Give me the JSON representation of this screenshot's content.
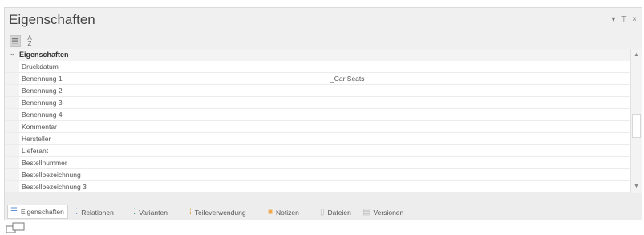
{
  "window": {
    "title": "Eigenschaften",
    "buttons": [
      {
        "name": "dropdown",
        "glyph": "▾"
      },
      {
        "name": "pin",
        "glyph": "⊤"
      },
      {
        "name": "close",
        "glyph": "×"
      }
    ]
  },
  "toolbar": {
    "categorized_icon": "categorized-view-icon",
    "sort_glyph_top": "A",
    "sort_glyph_bottom": "Z",
    "sort_icon": "sort-alphabetical-icon"
  },
  "grid": {
    "category": {
      "toggle": "⌄",
      "label": "Eigenschaften"
    },
    "rows": [
      {
        "name": "Druckdatum",
        "value": ""
      },
      {
        "name": "Benennung 1",
        "value": "_Car Seats"
      },
      {
        "name": "Benennung 2",
        "value": ""
      },
      {
        "name": "Benennung 3",
        "value": ""
      },
      {
        "name": "Benennung 4",
        "value": ""
      },
      {
        "name": "Kommentar",
        "value": ""
      },
      {
        "name": "Hersteller",
        "value": ""
      },
      {
        "name": "Lieferant",
        "value": ""
      },
      {
        "name": "Bestellnummer",
        "value": ""
      },
      {
        "name": "Bestellbezeichnung",
        "value": ""
      },
      {
        "name": "Bestellbezeichnung 3",
        "value": ""
      }
    ],
    "scrollbar": {
      "up_glyph": "▲",
      "down_glyph": "▼",
      "position": 0.55
    }
  },
  "tabs": [
    {
      "label": "Eigenschaften",
      "icon": "properties-icon",
      "glyph": "☰",
      "color": "#5b8fd6",
      "active": true
    },
    {
      "label": "Relationen",
      "icon": "relations-icon",
      "glyph": "⁚",
      "color": "#5b8fd6",
      "active": false
    },
    {
      "label": "Varianten",
      "icon": "variants-icon",
      "glyph": "⁚",
      "color": "#2e9e5b",
      "active": false
    },
    {
      "label": "Teileverwendung",
      "icon": "usage-icon",
      "glyph": "⁞",
      "color": "#d9a441",
      "active": false
    },
    {
      "label": "Notizen",
      "icon": "notes-icon",
      "glyph": "■",
      "color": "#f0a848",
      "active": false
    },
    {
      "label": "Dateien",
      "icon": "files-icon",
      "glyph": "▯",
      "color": "#bbbbbb",
      "active": false
    },
    {
      "label": "Versionen",
      "icon": "versions-icon",
      "glyph": "▤",
      "color": "#bbbbbb",
      "active": false
    }
  ],
  "colors": {
    "panel_bg": "#ededed",
    "grid_bg": "#ffffff",
    "gutter_bg": "#f3f3f3",
    "text": "#555555"
  }
}
